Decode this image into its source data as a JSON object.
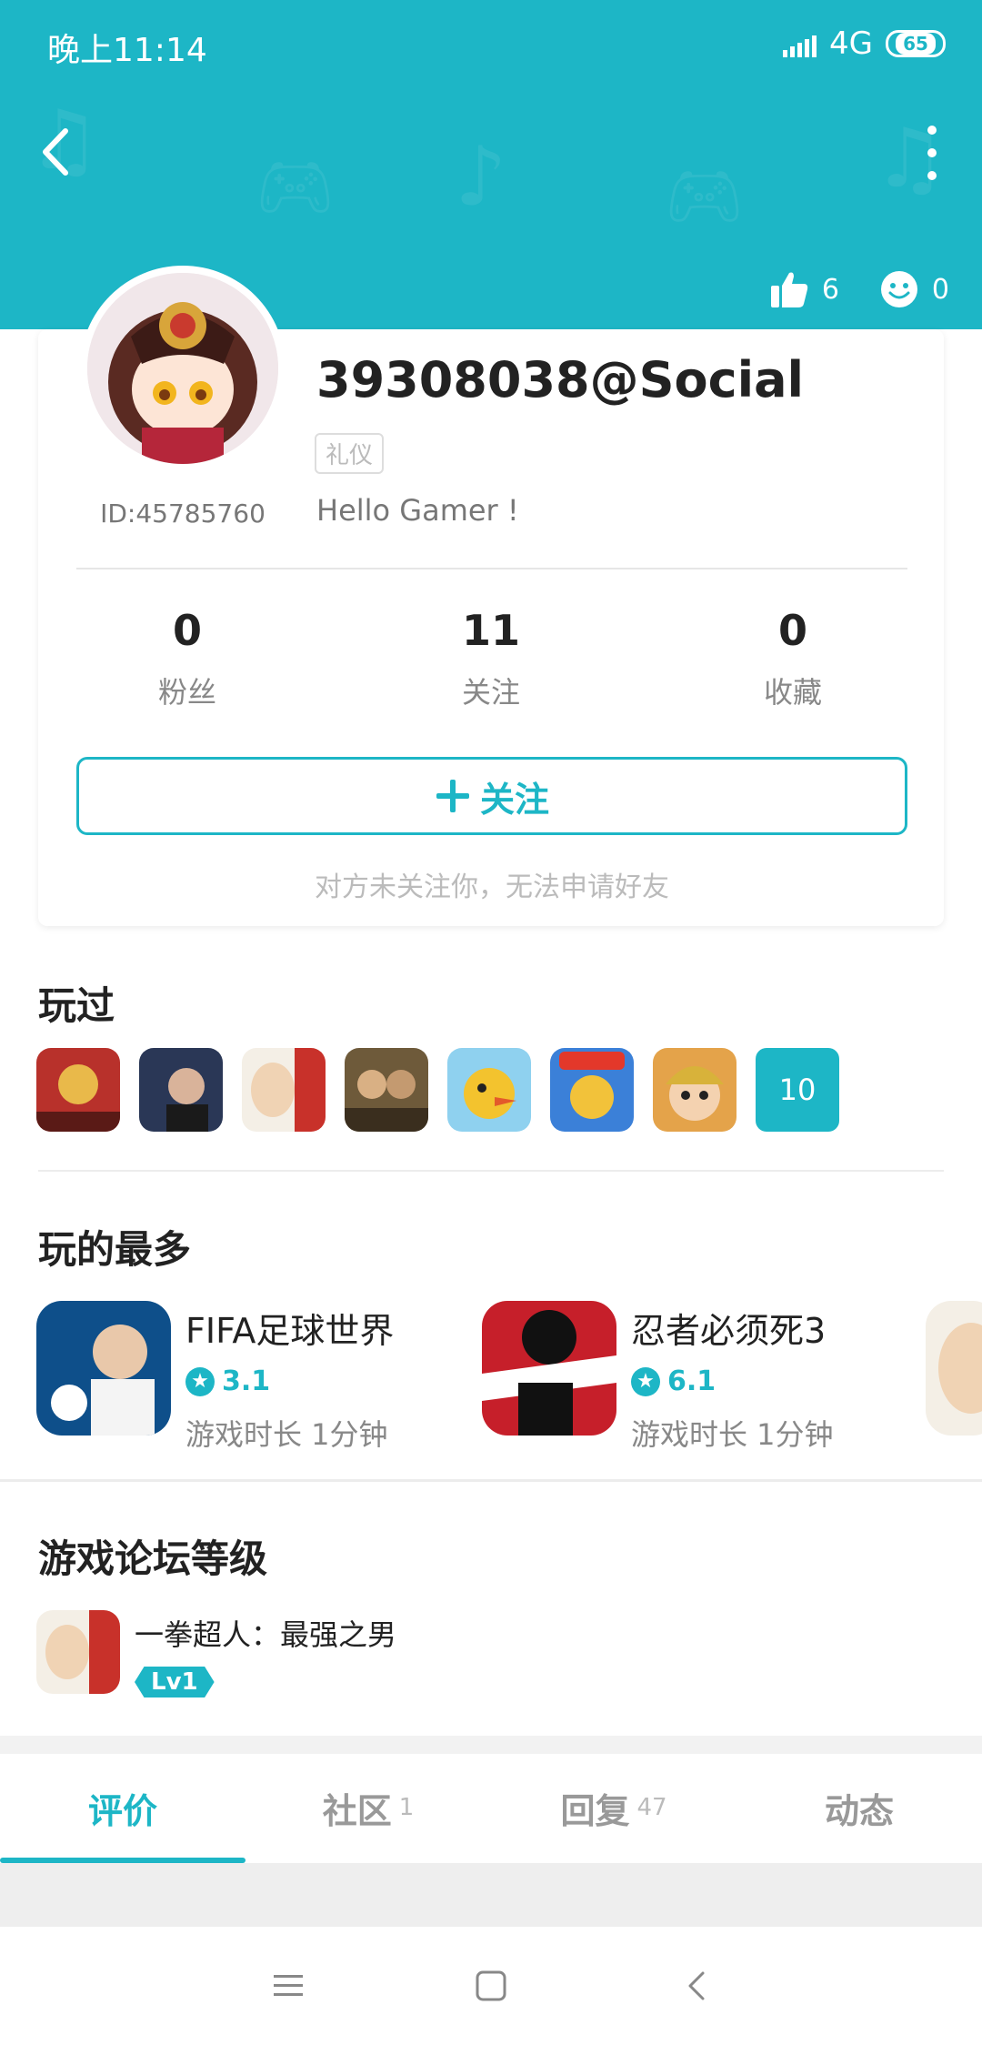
{
  "status_bar": {
    "time": "晚上11:14",
    "network": "4G",
    "battery": "65"
  },
  "header": {
    "likes_count": "6",
    "smile_count": "0"
  },
  "profile": {
    "username": "39308038@Social",
    "tag": "礼仪",
    "bio": "Hello Gamer !",
    "user_id": "ID:45785760",
    "stats": [
      {
        "value": "0",
        "label": "粉丝"
      },
      {
        "value": "11",
        "label": "关注"
      },
      {
        "value": "0",
        "label": "收藏"
      }
    ],
    "follow_label": "关注",
    "follow_hint": "对方未关注你，无法申请好友"
  },
  "played": {
    "title": "玩过",
    "more_count": "10",
    "games": [
      {
        "icon": "game-icon-1",
        "color": "#c03a2b"
      },
      {
        "icon": "game-icon-2",
        "color": "#2a3756"
      },
      {
        "icon": "game-icon-3",
        "color": "#e5c9a7"
      },
      {
        "icon": "game-icon-4",
        "color": "#6a5a3a"
      },
      {
        "icon": "game-icon-5",
        "color": "#e8b74a"
      },
      {
        "icon": "game-icon-6",
        "color": "#3a7ed6"
      },
      {
        "icon": "game-icon-7",
        "color": "#e07a2a"
      }
    ]
  },
  "most_played": {
    "title": "玩的最多",
    "items": [
      {
        "name": "FIFA足球世界",
        "score": "3.1",
        "time": "游戏时长 1分钟",
        "color": "#0e4f8a"
      },
      {
        "name": "忍者必须死3",
        "score": "6.1",
        "time": "游戏时长 1分钟",
        "color": "#c61f2a"
      }
    ]
  },
  "forum": {
    "title": "游戏论坛等级",
    "items": [
      {
        "name": "一拳超人：最强之男",
        "level": "Lv1"
      }
    ]
  },
  "tabs": [
    {
      "label": "评价",
      "count": ""
    },
    {
      "label": "社区",
      "count": "1"
    },
    {
      "label": "回复",
      "count": "47"
    },
    {
      "label": "动态",
      "count": ""
    }
  ],
  "colors": {
    "accent": "#1db6c6"
  }
}
